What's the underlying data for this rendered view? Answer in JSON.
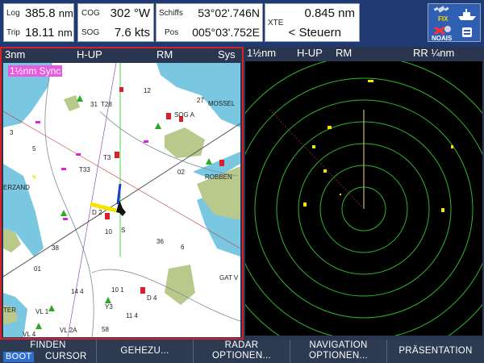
{
  "databar": {
    "log": {
      "label": "Log",
      "value": "385.8",
      "unit": "nm"
    },
    "trip": {
      "label": "Trip",
      "value": "18.11",
      "unit": "nm"
    },
    "cog": {
      "label": "COG",
      "value": "302 °W"
    },
    "sog": {
      "label": "SOG",
      "value": "7.6 kts"
    },
    "ship_lat": {
      "label": "Schiffs",
      "value": "53°02'.746N"
    },
    "ship_lon": {
      "label": "Pos",
      "value": "005°03'.752E"
    },
    "xte": {
      "label": "XTE",
      "value": "0.845 nm",
      "direction": "< Steuern"
    },
    "icons": {
      "fix_label": "FIX",
      "noais_label": "NOAIS"
    }
  },
  "chart_pane": {
    "range": "3nm",
    "orientation": "H-UP",
    "motion": "RM",
    "sys": "Sys",
    "sync_label": "1½nm Sync",
    "place_labels": [
      "MOSSEL",
      "SOG A",
      "ROBBEN",
      "ERZAND",
      "GAT V",
      "VL 1",
      "VL 2A",
      "VL 4",
      "TER"
    ],
    "depths": [
      "31",
      "T28",
      "12",
      "27",
      "3",
      "5",
      "T3",
      "T33",
      "D 2",
      "10",
      "S",
      "02",
      "38",
      "36",
      "6",
      "14 4",
      "10 1",
      "D 4",
      "11 4",
      "58",
      "01",
      "Y3"
    ]
  },
  "radar_pane": {
    "range": "1½nm",
    "orientation": "H-UP",
    "motion": "RM",
    "rings": "RR ¼nm"
  },
  "softkeys": [
    {
      "line1": "FINDEN",
      "line2": "CURSOR",
      "badge": "BOOT"
    },
    {
      "line1": "GEHEZU...",
      "line2": ""
    },
    {
      "line1": "RADAR",
      "line2": "OPTIONEN..."
    },
    {
      "line1": "NAVIGATION",
      "line2": "OPTIONEN..."
    },
    {
      "line1": "PRÄSENTATION",
      "line2": ""
    }
  ],
  "colors": {
    "active_border": "#d8202a",
    "chart_water": "#79c7e0",
    "chart_land": "#b9c98c",
    "radar_rings": "#2fb52f",
    "radar_targets": "#f5e400",
    "heading_line": "#4fd04f"
  }
}
